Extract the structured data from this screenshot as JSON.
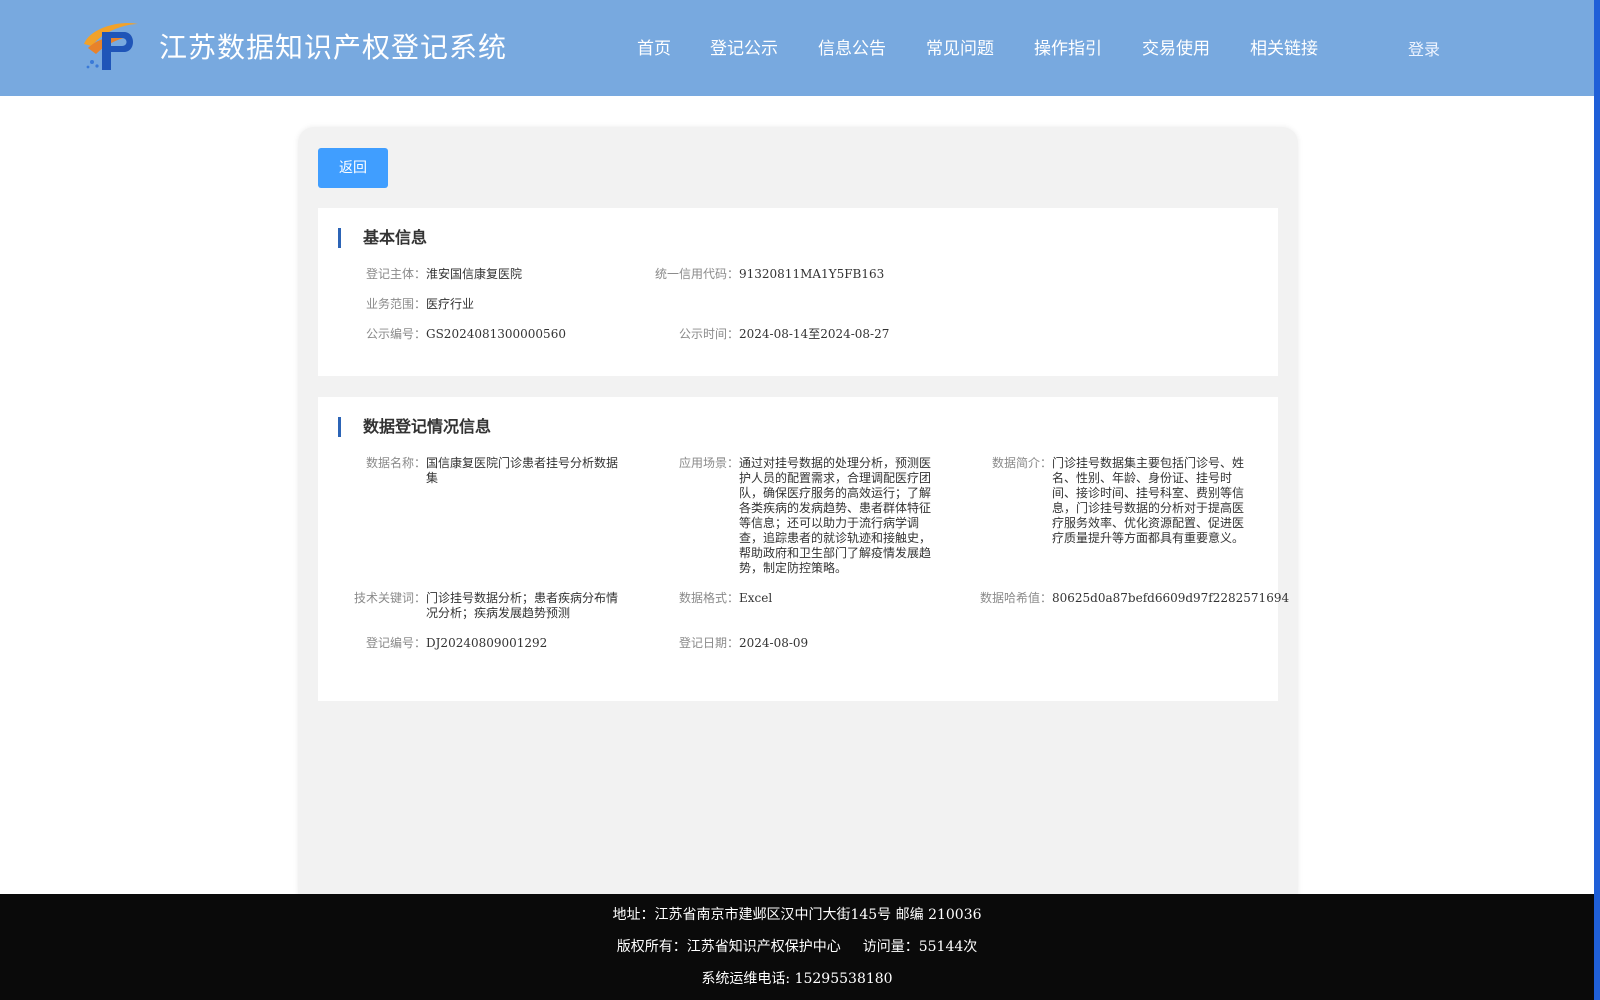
{
  "header": {
    "site_title": "江苏数据知识产权登记系统",
    "nav": [
      "首页",
      "登记公示",
      "信息公告",
      "常见问题",
      "操作指引",
      "交易使用",
      "相关链接"
    ],
    "login_label": "登录"
  },
  "actions": {
    "back_label": "返回"
  },
  "basic_info": {
    "title": "基本信息",
    "subject_label": "登记主体：",
    "subject_value": "淮安国信康复医院",
    "credit_code_label": "统一信用代码：",
    "credit_code_value": "91320811MA1Y5FB163",
    "scope_label": "业务范围：",
    "scope_value": "医疗行业",
    "notice_no_label": "公示编号：",
    "notice_no_value": "GS2024081300000560",
    "notice_time_label": "公示时间：",
    "notice_time_value": "2024-08-14至2024-08-27"
  },
  "registration_info": {
    "title": "数据登记情况信息",
    "data_name_label": "数据名称：",
    "data_name_value": "国信康复医院门诊患者挂号分析数据集",
    "scenario_label": "应用场景：",
    "scenario_value": "通过对挂号数据的处理分析，预测医护人员的配置需求，合理调配医疗团队，确保医疗服务的高效运行；了解各类疾病的发病趋势、患者群体特征等信息；还可以助力于流行病学调查，追踪患者的就诊轨迹和接触史，帮助政府和卫生部门了解疫情发展趋势，制定防控策略。",
    "summary_label": "数据简介：",
    "summary_value": "门诊挂号数据集主要包括门诊号、姓名、性别、年龄、身份证、挂号时间、接诊时间、挂号科室、费别等信息，门诊挂号数据的分析对于提高医疗服务效率、优化资源配置、促进医疗质量提升等方面都具有重要意义。",
    "keywords_label": "技术关键词：",
    "keywords_value": "门诊挂号数据分析；患者疾病分布情况分析；疾病发展趋势预测",
    "format_label": "数据格式：",
    "format_value": "Excel",
    "hash_label": "数据哈希值：",
    "hash_value": "80625d0a87befd6609d97f2282571694",
    "reg_no_label": "登记编号：",
    "reg_no_value": "DJ20240809001292",
    "reg_date_label": "登记日期：",
    "reg_date_value": "2024-08-09"
  },
  "footer": {
    "address": "地址：江苏省南京市建邺区汉中门大街145号 邮编 210036",
    "copyright": "版权所有：江苏省知识产权保护中心",
    "visits": "访问量：55144次",
    "hotline": "系统运维电话: 15295538180"
  }
}
